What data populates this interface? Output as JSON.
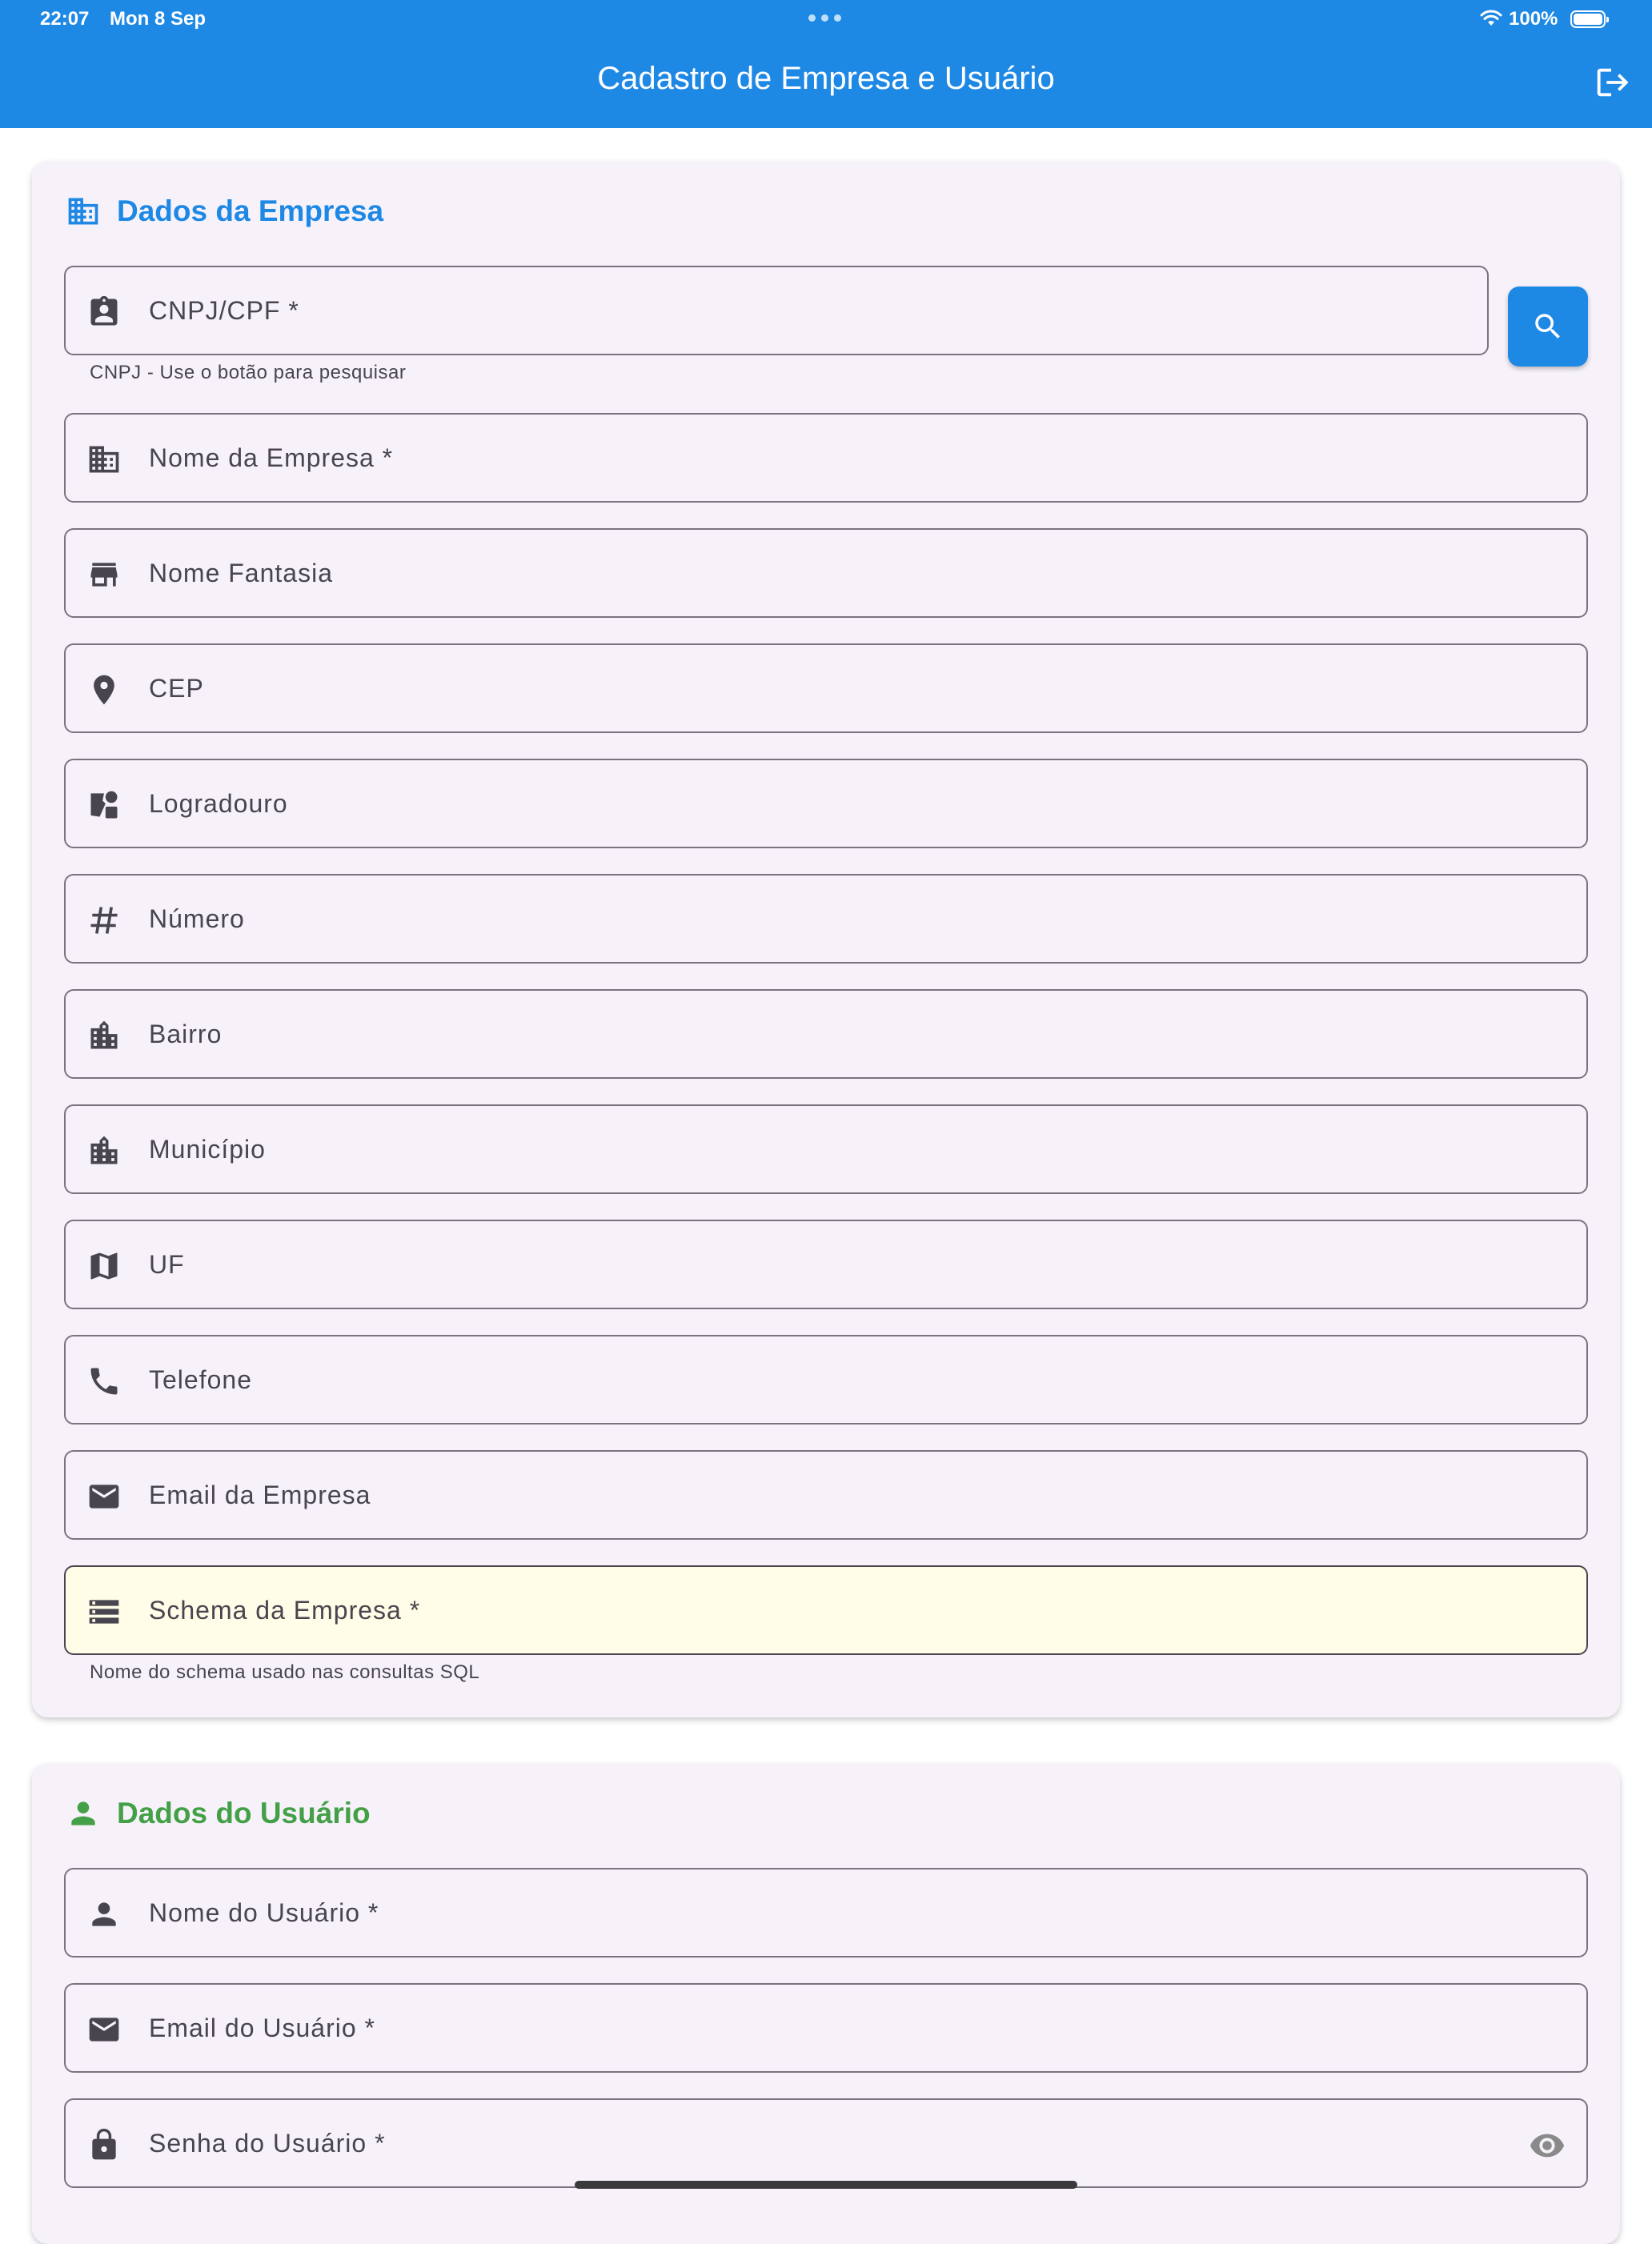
{
  "status_bar": {
    "time": "22:07",
    "date": "Mon 8 Sep",
    "battery": "100%"
  },
  "app_bar": {
    "title": "Cadastro de Empresa e Usuário"
  },
  "colors": {
    "primary": "#1e88e5",
    "user_section": "#43a047",
    "card_bg": "#f7f2fa",
    "schema_highlight": "#fffde7"
  },
  "company_section": {
    "title": "Dados da Empresa",
    "icon": "business-icon",
    "search_button_icon": "search-icon",
    "fields": [
      {
        "label": "CNPJ/CPF *",
        "icon": "badge-icon",
        "helper": "CNPJ - Use o botão para pesquisar"
      },
      {
        "label": "Nome da Empresa *",
        "icon": "business-icon"
      },
      {
        "label": "Nome Fantasia",
        "icon": "store-icon"
      },
      {
        "label": "CEP",
        "icon": "location-pin-icon"
      },
      {
        "label": "Logradouro",
        "icon": "map-shapes-icon"
      },
      {
        "label": "Número",
        "icon": "hashtag-icon"
      },
      {
        "label": "Bairro",
        "icon": "city-icon"
      },
      {
        "label": "Município",
        "icon": "city-icon"
      },
      {
        "label": "UF",
        "icon": "map-icon"
      },
      {
        "label": "Telefone",
        "icon": "phone-icon"
      },
      {
        "label": "Email da Empresa",
        "icon": "email-icon"
      },
      {
        "label": "Schema da Empresa *",
        "icon": "storage-icon",
        "helper": "Nome do schema usado nas consultas SQL"
      }
    ]
  },
  "user_section": {
    "title": "Dados do Usuário",
    "icon": "person-icon",
    "fields": [
      {
        "label": "Nome do Usuário *",
        "icon": "person-icon"
      },
      {
        "label": "Email do Usuário *",
        "icon": "email-icon"
      },
      {
        "label": "Senha do Usuário *",
        "icon": "lock-icon",
        "trailing_icon": "visibility-icon"
      }
    ]
  }
}
